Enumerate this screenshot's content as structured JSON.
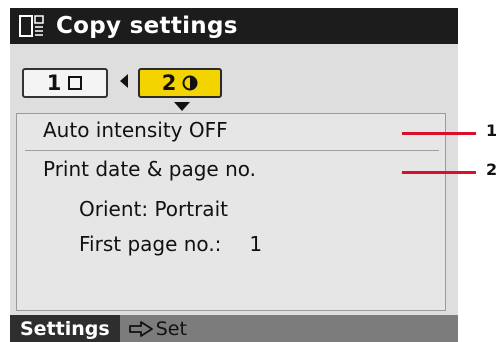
{
  "header": {
    "title": "Copy settings"
  },
  "pages": {
    "tabs": [
      {
        "label": "1",
        "selected": false
      },
      {
        "label": "2",
        "selected": true
      }
    ]
  },
  "settings": {
    "items": [
      {
        "label": "Auto intensity OFF"
      },
      {
        "label": "Print date & page no."
      },
      {
        "label": "Orient: Portrait"
      },
      {
        "label": "First page no.:",
        "value": "1"
      }
    ]
  },
  "footer": {
    "settings_label": "Settings",
    "set_label": "Set"
  },
  "callouts": [
    "1",
    "2"
  ],
  "colors": {
    "title_bar": "#1c1c1c",
    "selected_tab": "#f3d400",
    "callout_line": "#d8102a",
    "screen_bg": "#dedede",
    "bottom_bar": "#7c7c7c"
  }
}
